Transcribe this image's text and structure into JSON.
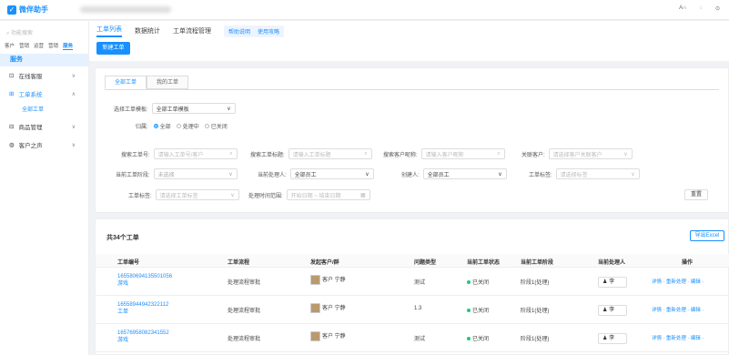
{
  "app": {
    "logo_glyph": "✓",
    "name": "微伴助手"
  },
  "topbar": {
    "items": [
      "A∩",
      "◌",
      "⊙"
    ]
  },
  "sidebar": {
    "search_placeholder": "⌕ 功能搜索",
    "apps": [
      "客户",
      "营销",
      "运营",
      "营销",
      "服务"
    ],
    "service_label": "服务",
    "menu": [
      {
        "label": "在线客服",
        "expanded": false
      },
      {
        "label": "工单系统",
        "expanded": true
      },
      {
        "label": "商品管理",
        "expanded": false
      },
      {
        "label": "客户之声",
        "expanded": false
      }
    ],
    "submenu": "全部工单"
  },
  "main_tabs": [
    "工单列表",
    "数据统计",
    "工单流程管理"
  ],
  "tab_pill": [
    "帮助说明",
    "使用攻略"
  ],
  "new_button": "新建工单",
  "filter": {
    "subtabs": [
      "全部工单",
      "我的工单"
    ],
    "template_label": "选择工单模板:",
    "template_value": "全部工单模板",
    "owner_label": "归属:",
    "owner_options": [
      "全部",
      "处理中",
      "已关闭"
    ],
    "row1": [
      {
        "label": "搜索工单号:",
        "placeholder": "请输入工单号/客户"
      },
      {
        "label": "搜索工单标题:",
        "placeholder": "请输入工单标题"
      },
      {
        "label": "搜索客户昵称:",
        "placeholder": "请输入客户昵称"
      },
      {
        "label": "关联客户:",
        "placeholder": "请选择客户关联客户"
      }
    ],
    "row2": [
      {
        "label": "当前工单阶段:",
        "value": "未选择"
      },
      {
        "label": "当前处理人:",
        "value": "全部员工"
      },
      {
        "label": "创建人:",
        "value": "全部员工"
      },
      {
        "label": "工单标签:",
        "value": "请选择标签"
      }
    ],
    "row3": [
      {
        "label": "工单标签:",
        "value": "请选择工单标签"
      },
      {
        "label": "处理时间范围:",
        "value": "开始日期 ~ 结束日期"
      }
    ],
    "reset_label": "重置"
  },
  "table": {
    "total": "共34个工单",
    "export_label": "导出Excel",
    "headers": [
      "工单编号",
      "工单流程",
      "发起客户/群",
      "问题类型",
      "当前工单状态",
      "当前工单阶段",
      "当前处理人",
      "操作"
    ],
    "rows": [
      {
        "id": "165580694135501056",
        "id2": "游戏",
        "flow": "处理流程审批",
        "customer": "客户 宁静",
        "issue": "测试",
        "status": "已关闭",
        "stage": "阶段1(处理)",
        "assignee": "李",
        "ops": "详情 · 重新处理 · 编辑 ·"
      },
      {
        "id": "16558944942322112",
        "id2": "工单",
        "flow": "处理流程审批",
        "customer": "客户 宁静",
        "issue": "1.3",
        "status": "已关闭",
        "stage": "阶段1(处理)",
        "assignee": "李",
        "ops": "详情 · 重新处理 · 编辑 ·"
      },
      {
        "id": "16576958082341552",
        "id2": "游戏",
        "flow": "处理流程审批",
        "customer": "客户 宁静",
        "issue": "测试",
        "status": "已关闭",
        "stage": "阶段1(处理)",
        "assignee": "李",
        "ops": "详情 · 重新处理 · 编辑 ·"
      }
    ]
  }
}
